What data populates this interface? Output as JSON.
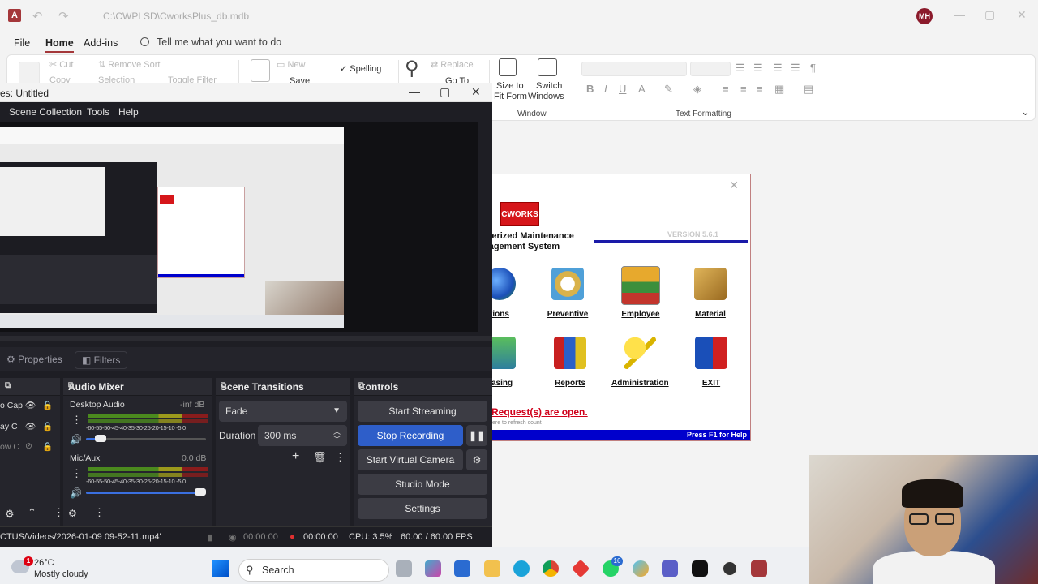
{
  "access": {
    "path": "C:\\CWPLSD\\CworksPlus_db.mdb",
    "user_initials": "MH",
    "menu": [
      "File",
      "Home",
      "Add-ins"
    ],
    "active_menu": "Home",
    "tell_me": "Tell me what you want to do",
    "ribbon": {
      "cut": "Cut",
      "copy": "Copy",
      "remove_sort": "Remove Sort",
      "selection": "Selection",
      "toggle_filter": "Toggle Filter",
      "new": "New",
      "save": "Save",
      "spelling": "Spelling",
      "replace": "Replace",
      "go_to": "Go To",
      "size_to_fit_1": "Size to",
      "size_to_fit_2": "Fit Form",
      "switch_windows_1": "Switch",
      "switch_windows_2": "Windows",
      "group_window": "Window",
      "group_text_formatting": "Text Formatting"
    }
  },
  "cworks": {
    "logo": "CWORKS",
    "title_line1": "uterized Maintenance",
    "title_line2": "nagement System",
    "version": "VERSION 5.6.1",
    "modules": [
      "tions",
      "Preventive",
      "Employee",
      "Material",
      "hasing",
      "Reports",
      "Administration",
      "EXIT"
    ],
    "requests": "Request(s) are open.",
    "refresh_hint": "ere to refresh count",
    "footer": "Press F1 for Help"
  },
  "obs": {
    "title": "es: Untitled",
    "menu": [
      "Scene Collection",
      "Tools",
      "Help"
    ],
    "properties": "Properties",
    "filters": "Filters",
    "docks": {
      "mixer": "Audio Mixer",
      "transitions": "Scene Transitions",
      "controls": "Controls"
    },
    "sources": [
      "o Cap",
      "ay C",
      "ow C"
    ],
    "mixer": {
      "ch1_name": "Desktop Audio",
      "ch1_db": "-inf dB",
      "ch2_name": "Mic/Aux",
      "ch2_db": "0.0 dB",
      "scale": "-60-55-50-45-40-35-30-25-20-15-10 -5  0",
      "ch1_level": 0.08,
      "ch2_level": 1.0
    },
    "transitions": {
      "type": "Fade",
      "duration_label": "Duration",
      "duration_value": "300 ms"
    },
    "controls": {
      "start_streaming": "Start Streaming",
      "stop_recording": "Stop Recording",
      "start_virtual_camera": "Start Virtual Camera",
      "studio_mode": "Studio Mode",
      "settings": "Settings"
    },
    "status": {
      "path": "CTUS/Videos/2026-01-09 09-52-11.mp4'",
      "stream_time": "00:00:00",
      "rec_time": "00:00:00",
      "cpu": "CPU: 3.5%",
      "fps": "60.00 / 60.00 FPS"
    }
  },
  "taskbar": {
    "weather_temp": "26°C",
    "weather_desc": "Mostly cloudy",
    "weather_badge": "1",
    "search": "Search",
    "whatsapp_badge": "16"
  },
  "colors": {
    "obs_active": "#2e5ec9",
    "access_accent": "#a4373a",
    "cworks_blue": "#0000cc",
    "cworks_red": "#d6161a"
  }
}
